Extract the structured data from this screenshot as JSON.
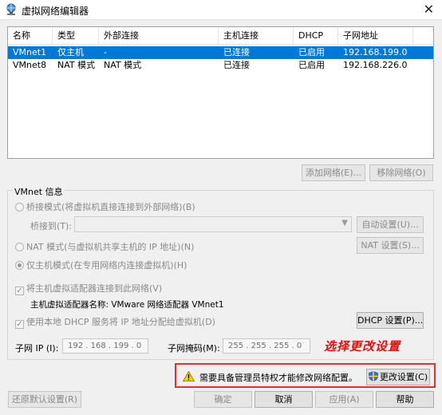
{
  "window": {
    "title": "虚拟网络编辑器",
    "close_glyph": "✕"
  },
  "columns": [
    "名称",
    "类型",
    "外部连接",
    "主机连接",
    "DHCP",
    "子网地址"
  ],
  "networks": [
    {
      "name": "VMnet1",
      "type": "仅主机",
      "external": "-",
      "host": "已连接",
      "dhcp": "已启用",
      "subnet": "192.168.199.0",
      "selected": true
    },
    {
      "name": "VMnet8",
      "type": "NAT 模式",
      "external": "NAT 模式",
      "host": "已连接",
      "dhcp": "已启用",
      "subnet": "192.168.226.0",
      "selected": false
    }
  ],
  "list_buttons": {
    "add": "添加网络(E)...",
    "remove": "移除网络(O)"
  },
  "vmnet_info": {
    "group_label": "VMnet 信息",
    "bridged": "桥接模式(将虚拟机直接连接到外部网络)(B)",
    "bridged_to_label": "桥接到(T):",
    "auto_settings": "自动设置(U)...",
    "nat": "NAT 模式(与虚拟机共享主机的 IP 地址)(N)",
    "nat_settings": "NAT 设置(S)...",
    "host_only": "仅主机模式(在专用网络内连接虚拟机)(H)",
    "connect_adapter": "将主机虚拟适配器连接到此网络(V)",
    "adapter_name": "主机虚拟适配器名称: VMware 网络适配器 VMnet1",
    "use_dhcp": "使用本地 DHCP 服务将 IP 地址分配给虚拟机(D)",
    "dhcp_settings": "DHCP 设置(P)...",
    "subnet_ip_label": "子网 IP (I):",
    "subnet_ip": "192 . 168 . 199 .  0",
    "subnet_mask_label": "子网掩码(M):",
    "subnet_mask": "255 . 255 . 255 .  0"
  },
  "annotation": "选择更改设置",
  "admin": {
    "warning": "需要具备管理员特权才能修改网络配置。",
    "change_settings": "更改设置(C)"
  },
  "footer": {
    "restore": "还原默认设置(R)",
    "ok": "确定",
    "cancel": "取消",
    "apply": "应用(A)",
    "help": "帮助"
  },
  "colors": {
    "selection": "#0078d7",
    "annotation": "#e01010",
    "highlight_border": "#e23030"
  }
}
